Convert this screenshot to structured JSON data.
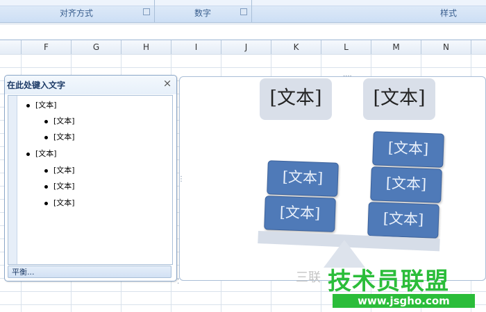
{
  "ribbon": {
    "groups": [
      {
        "label": "对齐方式"
      },
      {
        "label": "数字"
      },
      {
        "label": "样式"
      }
    ]
  },
  "columns": [
    "F",
    "G",
    "H",
    "I",
    "J",
    "K",
    "L",
    "M",
    "N"
  ],
  "text_pane": {
    "title": "在此处键入文字",
    "close": "×",
    "items": [
      {
        "label": "[文本]",
        "level": 1
      },
      {
        "label": "[文本]",
        "level": 2
      },
      {
        "label": "[文本]",
        "level": 2
      },
      {
        "label": "[文本]",
        "level": 1
      },
      {
        "label": "[文本]",
        "level": 2
      },
      {
        "label": "[文本]",
        "level": 2
      },
      {
        "label": "[文本]",
        "level": 2
      }
    ],
    "footer": "平衡..."
  },
  "smartart": {
    "header_left": "[文本]",
    "header_right": "[文本]",
    "left_boxes": [
      "[文本]",
      "[文本]"
    ],
    "right_boxes": [
      "[文本]",
      "[文本]",
      "[文本]"
    ],
    "colors": {
      "box": "#4f7ab8",
      "header": "#d9dfe9",
      "beam": "#d6dde8"
    }
  },
  "watermark": {
    "faint_text": "三联",
    "brand": "技术员联盟",
    "url": "www.jsgho.com"
  }
}
